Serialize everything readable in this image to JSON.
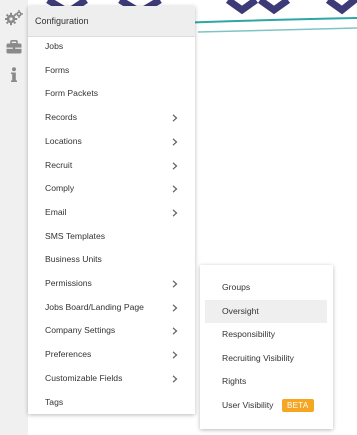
{
  "rail": {
    "icons": [
      "gears-icon",
      "briefcase-icon",
      "info-icon"
    ]
  },
  "menu": {
    "header": "Configuration",
    "items": [
      {
        "label": "Jobs",
        "has_submenu": false
      },
      {
        "label": "Forms",
        "has_submenu": false
      },
      {
        "label": "Form Packets",
        "has_submenu": false
      },
      {
        "label": "Records",
        "has_submenu": true
      },
      {
        "label": "Locations",
        "has_submenu": true
      },
      {
        "label": "Recruit",
        "has_submenu": true
      },
      {
        "label": "Comply",
        "has_submenu": true
      },
      {
        "label": "Email",
        "has_submenu": true
      },
      {
        "label": "SMS Templates",
        "has_submenu": false
      },
      {
        "label": "Business Units",
        "has_submenu": false
      },
      {
        "label": "Permissions",
        "has_submenu": true
      },
      {
        "label": "Jobs Board/Landing Page",
        "has_submenu": true
      },
      {
        "label": "Company Settings",
        "has_submenu": true
      },
      {
        "label": "Preferences",
        "has_submenu": true
      },
      {
        "label": "Customizable Fields",
        "has_submenu": true
      },
      {
        "label": "Tags",
        "has_submenu": false
      }
    ]
  },
  "submenu": {
    "parent": "Permissions",
    "items": [
      {
        "label": "Groups",
        "active": false
      },
      {
        "label": "Oversight",
        "active": true
      },
      {
        "label": "Responsibility",
        "active": false
      },
      {
        "label": "Recruiting Visibility",
        "active": false
      },
      {
        "label": "Rights",
        "active": false
      },
      {
        "label": "User Visibility",
        "active": false,
        "badge": "BETA"
      }
    ]
  },
  "colors": {
    "rail_bg": "#f0f0f0",
    "header_bg": "#eeeeee",
    "active_bg": "#efefef",
    "badge_bg": "#f5a623",
    "brand_purple": "#3d3a78",
    "brand_teal": "#2ea6a6",
    "text": "#333333"
  }
}
